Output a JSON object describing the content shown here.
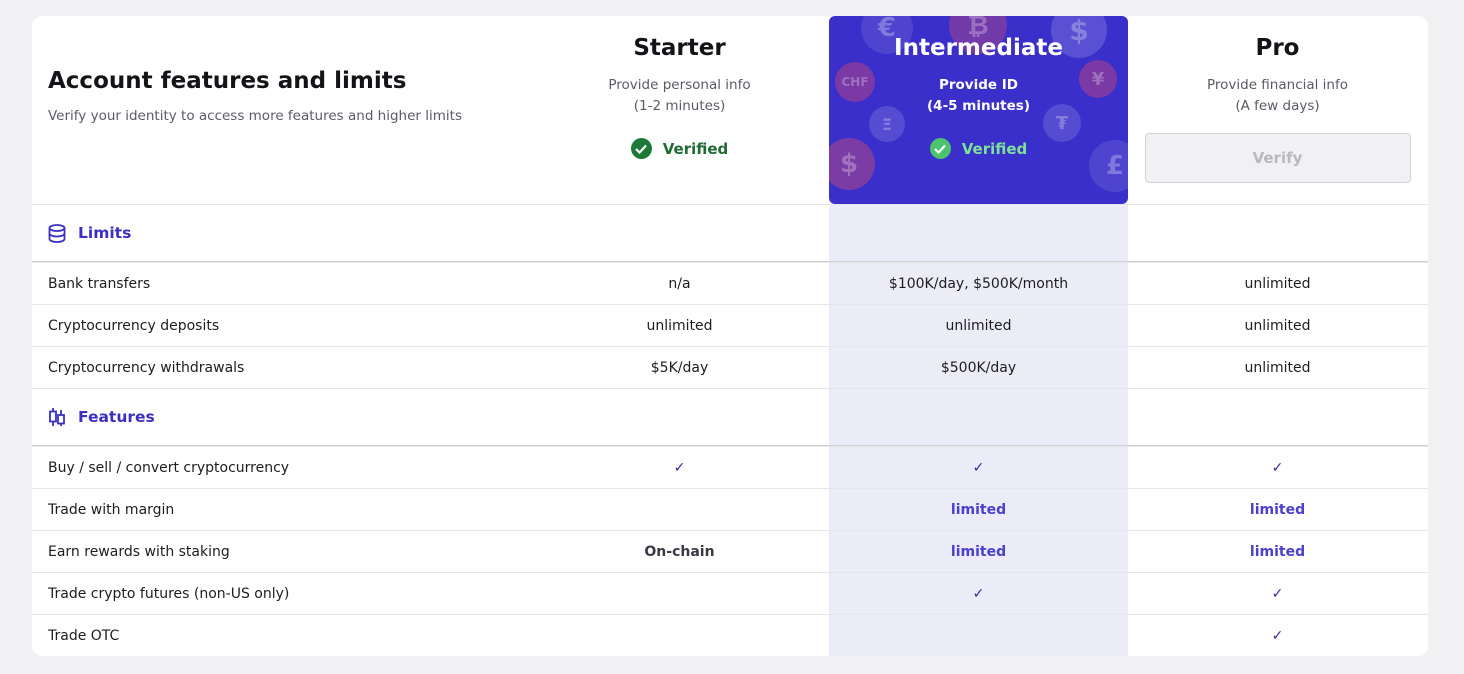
{
  "header": {
    "title": "Account features and limits",
    "subtitle": "Verify your identity to access more features and higher limits"
  },
  "tiers": [
    {
      "name": "Starter",
      "req_line1": "Provide personal info",
      "req_line2": "(1-2 minutes)",
      "status": "Verified"
    },
    {
      "name": "Intermediate",
      "req_line1": "Provide ID",
      "req_line2": "(4-5 minutes)",
      "status": "Verified"
    },
    {
      "name": "Pro",
      "req_line1": "Provide financial info",
      "req_line2": "(A few days)",
      "button": "Verify"
    }
  ],
  "sections": {
    "limits": {
      "label": "Limits",
      "icon": "database-icon",
      "rows": [
        {
          "label": "Bank transfers",
          "starter": "n/a",
          "intermediate": "$100K/day, $500K/month",
          "pro": "unlimited"
        },
        {
          "label": "Cryptocurrency deposits",
          "starter": "unlimited",
          "intermediate": "unlimited",
          "pro": "unlimited"
        },
        {
          "label": "Cryptocurrency withdrawals",
          "starter": "$5K/day",
          "intermediate": "$500K/day",
          "pro": "unlimited"
        }
      ]
    },
    "features": {
      "label": "Features",
      "icon": "candlestick-icon",
      "rows": [
        {
          "label": "Buy / sell / convert cryptocurrency",
          "starter": "✓",
          "intermediate": "✓",
          "pro": "✓"
        },
        {
          "label": "Trade with margin",
          "starter": "",
          "intermediate": "limited",
          "pro": "limited"
        },
        {
          "label": "Earn rewards with staking",
          "starter": "On-chain",
          "intermediate": "limited",
          "pro": "limited"
        },
        {
          "label": "Trade crypto futures (non-US only)",
          "starter": "",
          "intermediate": "✓",
          "pro": "✓"
        },
        {
          "label": "Trade OTC",
          "starter": "",
          "intermediate": "",
          "pro": "✓"
        }
      ]
    }
  },
  "hero_coins": [
    "€",
    "₿",
    "$",
    "CHF",
    "¥",
    "Ξ",
    "₮",
    "$",
    "£"
  ],
  "colors": {
    "accent": "#3b2fcb",
    "highlight_column": "#ecebf8",
    "verified_green": "#1f7a3a",
    "limited_text": "#4a3fd0"
  }
}
